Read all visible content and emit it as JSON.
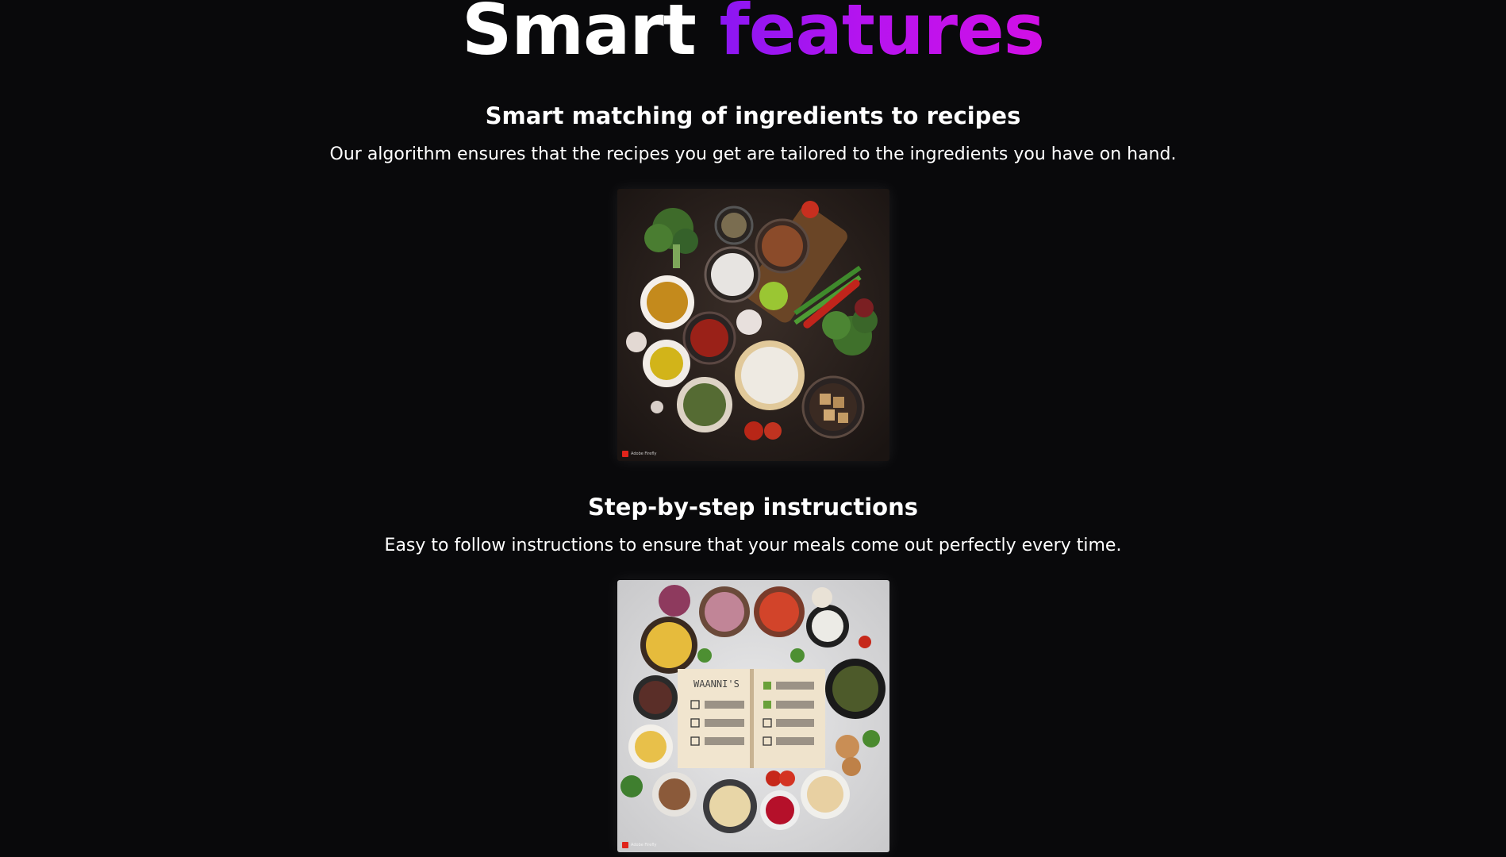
{
  "section": {
    "title_plain": "Smart",
    "title_accent": "features"
  },
  "features": [
    {
      "heading": "Smart matching of ingredients to recipes",
      "description": "Our algorithm ensures that the recipes you get are tailored to the ingredients you have on hand.",
      "image_icon": "ingredients-photo",
      "watermark": "Adobe Firefly"
    },
    {
      "heading": "Step-by-step instructions",
      "description": "Easy to follow instructions to ensure that your meals come out perfectly every time.",
      "image_icon": "recipe-book-photo",
      "book_heading": "WAANNI'S",
      "watermark": "Adobe Firefly"
    }
  ],
  "colors": {
    "background": "#09090b",
    "accent_start": "#8b16f2",
    "accent_end": "#d20fe6"
  }
}
